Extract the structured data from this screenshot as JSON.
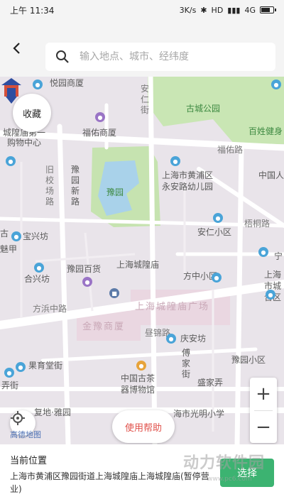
{
  "status_bar": {
    "time": "上午 11:34",
    "network": "3K/s",
    "signal_text": "HD",
    "cell": "4G",
    "battery_level": 0.75
  },
  "header": {
    "back_icon": "chevron-left-icon",
    "search_icon": "search-icon",
    "search_placeholder": "输入地点、城市、经纬度"
  },
  "map": {
    "favorite_label": "收藏",
    "help_label": "使用帮助",
    "zoom_in": "+",
    "zoom_out": "−",
    "logo_text": "高德地图",
    "labels": {
      "yueyuan_shangchang": "悦园商厦",
      "fuyou_shangsha": "福佑商厦",
      "chenghuangmiao_first": "城隍庙第一",
      "gouwu_zhongxin": "购物中心",
      "jiu_xiao_lu": "旧校场路",
      "yuyuan_xinlu": "豫园新路",
      "yuyuan": "豫园",
      "anren_jie": "安仁街",
      "gucheng_park": "古城公园",
      "baishi_jie": "百姓健身",
      "fuyou_lu": "福佑路",
      "huangpu_kindergarten_1": "上海市黄浦区",
      "huangpu_kindergarten_2": "永安路幼儿园",
      "zhongguo_ren": "中国人",
      "baoxing_fang": "宝兴坊",
      "anren_xiaoqu": "安仁小区",
      "meijia_lu": "梧桐路",
      "yuyuan_baihuo": "豫园百货",
      "chenghuangmiao": "上海城隍庙",
      "fangzhong_xiaoqu": "方中小区",
      "hexing_fang": "合兴坊",
      "fangbang_zhonglu": "方浜中路",
      "chenghuangmiao_square": "上海城隍庙广场",
      "jinxiu_shangsha": "金豫商厦",
      "jinglu": "昼锦路",
      "qingan_fang": "庆安坊",
      "yuyuan_xiaoqu": "豫园小区",
      "guoyu_jie": "果育堂街",
      "chunhua_jie": "弄街",
      "chajia_jie": "傅家街",
      "shengjia_nong": "盛家弄",
      "tea_museum_1": "中国古茶",
      "tea_museum_2": "器博物馆",
      "fuxing_garden": "复地·雅园",
      "guangming_school": "海市光明小学",
      "shanghai_right": "上海",
      "shanghai_right2": "市城",
      "shanghai_right3": "合区",
      "zhi_right": "宁",
      "left_jie": "魅甲",
      "left_gu": "古"
    }
  },
  "bottom": {
    "title": "当前位置",
    "address": "上海市黄浦区豫园街道上海城隍庙上海城隍庙(暂停营业)",
    "select_label": "选择",
    "watermark": "动力软件园",
    "watermark_url": "www.pc6.com"
  },
  "colors": {
    "accent_green": "#3cb371",
    "help_red": "#e0504a",
    "map_bg": "#e9e4ea",
    "park_green": "#c9e6b4"
  }
}
